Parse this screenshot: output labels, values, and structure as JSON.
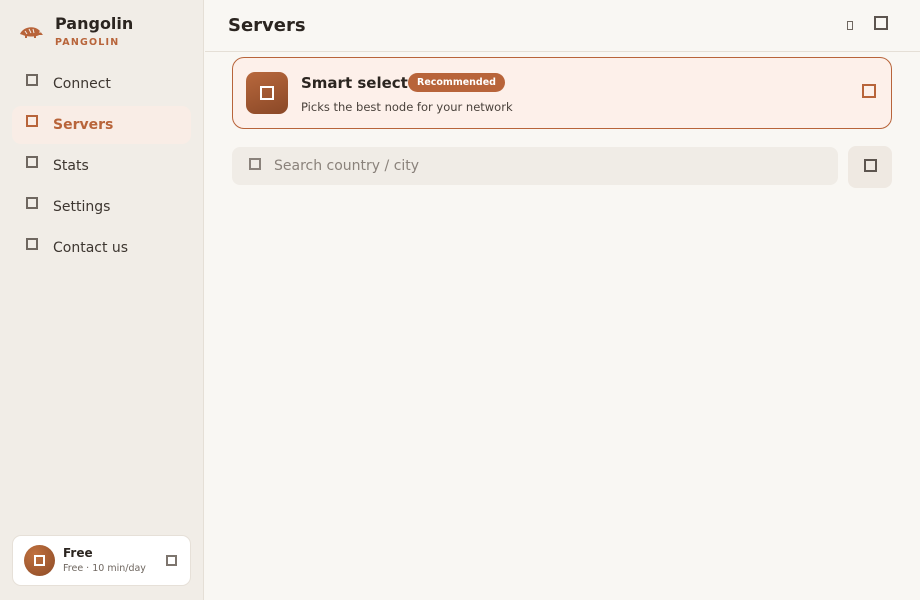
{
  "brand": {
    "name": "Pangolin",
    "subtitle": "PANGOLIN",
    "logo_icon": "pangolin-logo-icon",
    "accent": "#b8643a"
  },
  "sidebar": {
    "items": [
      {
        "label": "Connect",
        "icon": "connect-icon",
        "active": false
      },
      {
        "label": "Servers",
        "icon": "servers-icon",
        "active": true
      },
      {
        "label": "Stats",
        "icon": "stats-icon",
        "active": false
      },
      {
        "label": "Settings",
        "icon": "settings-icon",
        "active": false
      },
      {
        "label": "Contact us",
        "icon": "contact-icon",
        "active": false
      }
    ]
  },
  "plan": {
    "name": "Free",
    "description": "Free · 10 min/day",
    "avatar_icon": "plan-avatar-icon",
    "action_icon": "plan-action-icon"
  },
  "header": {
    "title": "Servers",
    "icons": [
      "small-icon",
      "menu-icon"
    ]
  },
  "smart_select": {
    "title": "Smart select",
    "badge": "Recommended",
    "subtitle": "Picks the best node for your network",
    "icon": "smart-select-icon",
    "selected": true
  },
  "search": {
    "placeholder": "Search country / city",
    "value": "",
    "filter_icon": "filter-icon"
  },
  "colors": {
    "accent": "#b8643a",
    "sidebar_bg": "#f1ede7",
    "main_bg": "#f9f7f3",
    "card_bg": "#fdf0ea"
  }
}
